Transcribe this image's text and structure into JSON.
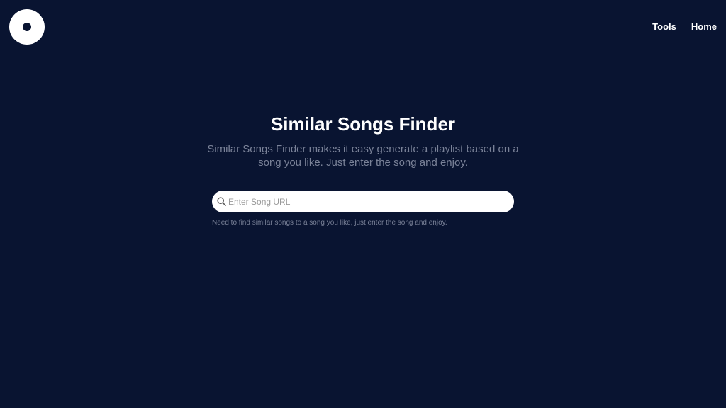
{
  "header": {
    "logo_icon": "vinyl-record-icon",
    "nav": [
      {
        "label": "Tools"
      },
      {
        "label": "Home"
      }
    ]
  },
  "hero": {
    "title": "Similar Songs Finder",
    "subtitle": "Similar Songs Finder makes it easy generate a playlist based on a song you like. Just enter the song and enjoy."
  },
  "search": {
    "icon": "search-icon",
    "placeholder": "Enter Song URL",
    "value": "",
    "helper": "Need to find similar songs to a song you like, just enter the song and enjoy."
  },
  "colors": {
    "background": "#091431",
    "text_primary": "#ffffff",
    "text_muted": "#7a8298",
    "input_bg": "#ffffff"
  }
}
